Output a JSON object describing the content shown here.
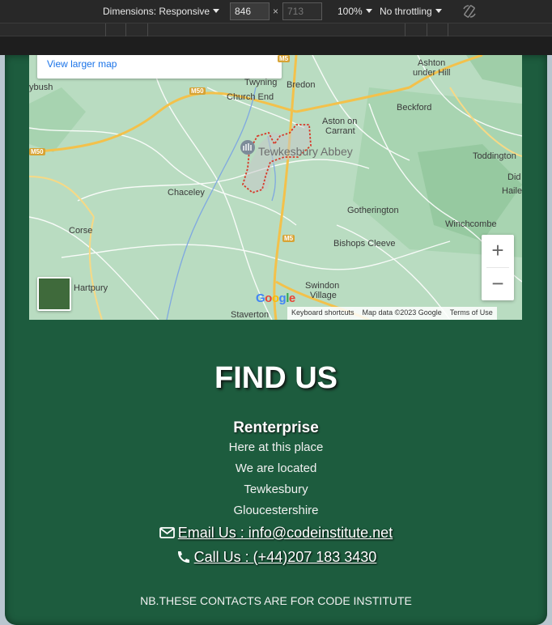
{
  "devtools": {
    "dimensions_label": "Dimensions: Responsive",
    "width_value": "846",
    "times": "×",
    "height_placeholder": "713",
    "zoom": "100%",
    "throttling": "No throttling"
  },
  "map": {
    "view_larger": "View larger map",
    "labels": {
      "ashton": "Ashton",
      "ashton2": "under Hill",
      "twyning": "Twyning",
      "bredon": "Bredon",
      "church_end": "Church End",
      "ybush": "ybush",
      "beckford": "Beckford",
      "aston": "Aston on",
      "aston2": "Carrant",
      "tewkesbury": "Tewkesbury Abbey",
      "toddington": "Toddington",
      "did": "Did",
      "haile": "Haile",
      "chaceley": "Chaceley",
      "gotherington": "Gotherington",
      "winchcombe": "Winchcombe",
      "corse": "Corse",
      "bishops": "Bishops Cleeve",
      "hartpury": "Hartpury",
      "swindon": "Swindon",
      "swindon2": "Village",
      "staverton": "Staverton"
    },
    "roads": {
      "m50a": "M50",
      "m50b": "M50",
      "m5": "M5",
      "m5top": "M5"
    },
    "zoom_in": "+",
    "zoom_out": "−",
    "attribution": {
      "shortcuts": "Keyboard shortcuts",
      "data": "Map data ©2023 Google",
      "terms": "Terms of Use"
    },
    "logo": {
      "g": "G",
      "o1": "o",
      "o2": "o",
      "g2": "g",
      "l": "l",
      "e": "e"
    }
  },
  "contact": {
    "heading": "FIND US",
    "company": "Renterprise",
    "address": [
      "Here at this place",
      "We are located",
      "Tewkesbury",
      "Gloucestershire"
    ],
    "email": "Email Us : info@codeinstitute.net",
    "phone": "Call Us : (+44)207 183 3430",
    "note": "NB.THESE CONTACTS ARE FOR CODE INSTITUTE"
  },
  "colors": {
    "footer_bg": "#1d5c3e",
    "link": "#1a73e8"
  }
}
